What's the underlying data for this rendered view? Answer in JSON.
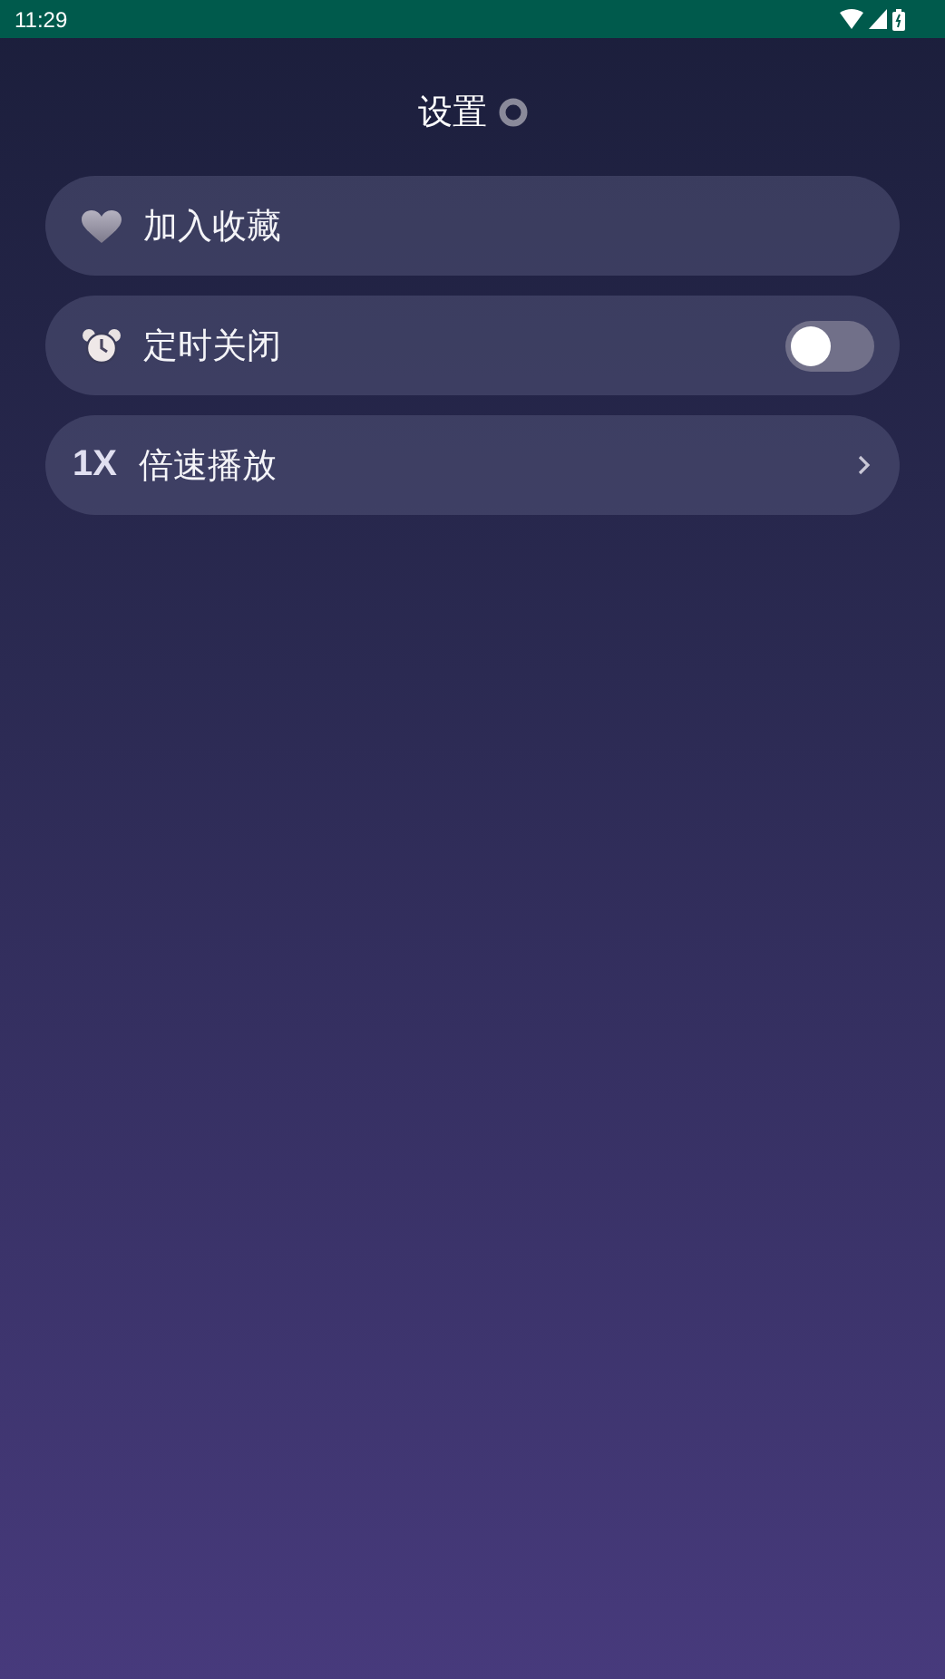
{
  "status_bar": {
    "time": "11:29"
  },
  "title": "设置",
  "items": [
    {
      "kind": "favorite",
      "label": "加入收藏"
    },
    {
      "kind": "timer",
      "label": "定时关闭",
      "on": false
    },
    {
      "kind": "speed",
      "badge": "1X",
      "label": "倍速播放"
    }
  ]
}
